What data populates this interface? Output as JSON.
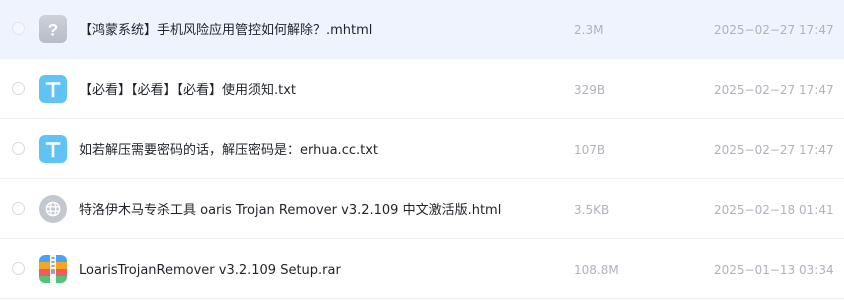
{
  "files": [
    {
      "name": "【鸿蒙系统】手机风险应用管控如何解除？.mhtml",
      "size": "2.3M",
      "date": "2025−02−27 17:47",
      "icon": "unknown-file-icon",
      "selected": true
    },
    {
      "name": "【必看】【必看】【必看】使用须知.txt",
      "size": "329B",
      "date": "2025−02−27 17:47",
      "icon": "text-file-icon"
    },
    {
      "name": "如若解压需要密码的话，解压密码是：erhua.cc.txt",
      "size": "107B",
      "date": "2025−02−27 17:47",
      "icon": "text-file-icon"
    },
    {
      "name": "特洛伊木马专杀工具 oaris Trojan Remover v3.2.109 中文激活版.html",
      "size": "3.5KB",
      "date": "2025−02−18 01:41",
      "icon": "web-file-icon"
    },
    {
      "name": "LoarisTrojanRemover v3.2.109 Setup.rar",
      "size": "108.8M",
      "date": "2025−01−13 03:34",
      "icon": "archive-file-icon"
    }
  ],
  "colors": {
    "selected_row": "#eef3fd",
    "text_icon": "#5fc3f5",
    "unknown_icon": "#c4c9d3",
    "web_icon": "#bcc1ca"
  }
}
